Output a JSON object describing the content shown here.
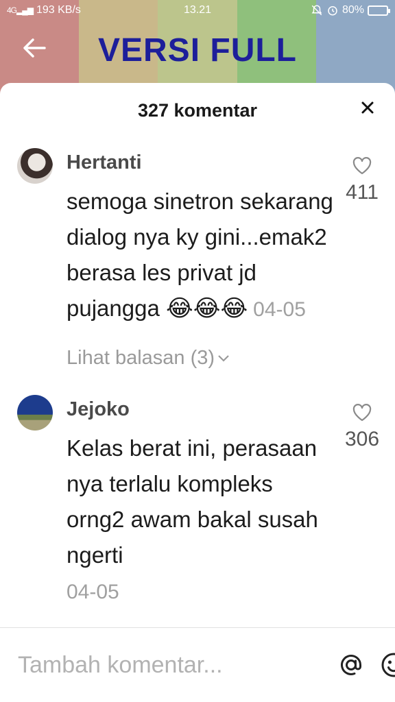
{
  "status_bar": {
    "network_tag": "4G",
    "speed": "193 KB/s",
    "time": "13.21",
    "battery": "80%"
  },
  "banner": {
    "title": "VERSI FULL"
  },
  "sheet": {
    "title": "327 komentar"
  },
  "comments": [
    {
      "username": "Hertanti",
      "text": "semoga sinetron sekarang dialog nya ky gini...emak2 berasa les privat jd pujangga ",
      "emoji": "😂😂😂",
      "date": "04-05",
      "likes": "411",
      "replies": "Lihat balasan (3)"
    },
    {
      "username": "Jejoko",
      "text": "Kelas berat ini, perasaan nya terlalu kompleks orng2 awam bakal susah ngerti",
      "date": "04-05",
      "likes": "306"
    }
  ],
  "input": {
    "placeholder": "Tambah komentar..."
  },
  "icons": [
    "back-arrow-icon",
    "close-icon",
    "heart-icon",
    "chevron-down-icon",
    "at-icon",
    "emoji-icon"
  ]
}
